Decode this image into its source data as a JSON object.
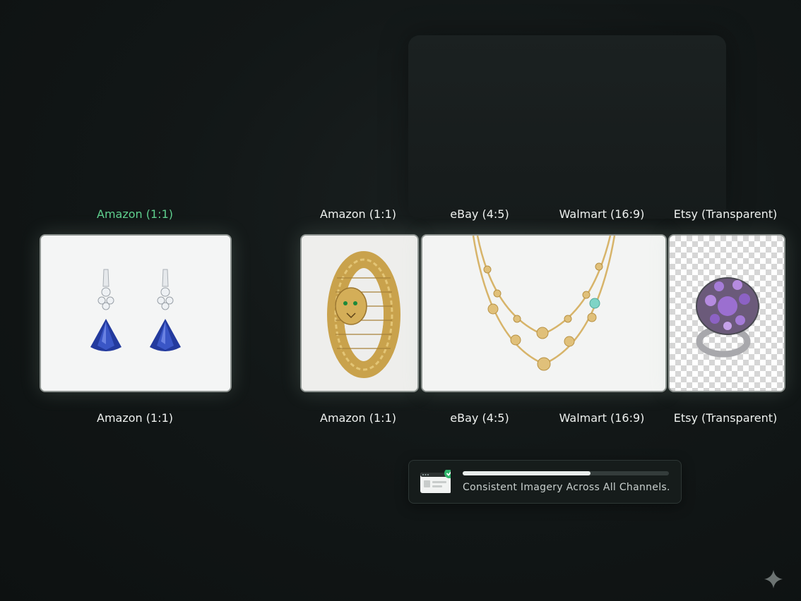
{
  "top_labels": {
    "left": "Amazon (1:1)",
    "amazon": "Amazon (1:1)",
    "ebay": "eBay (4:5)",
    "walmart": "Walmart (16:9)",
    "etsy": "Etsy (Transparent)"
  },
  "bottom_labels": {
    "left": "Amazon (1:1)",
    "amazon": "Amazon (1:1)",
    "ebay": "eBay (4:5)",
    "walmart": "Walmart (16:9)",
    "etsy": "Etsy (Transparent)"
  },
  "toast": {
    "message": "Consistent Imagery Across All Channels.",
    "progress": 0.62
  },
  "colors": {
    "active_label": "#5fcf8e",
    "check_badge": "#2fb56b"
  }
}
